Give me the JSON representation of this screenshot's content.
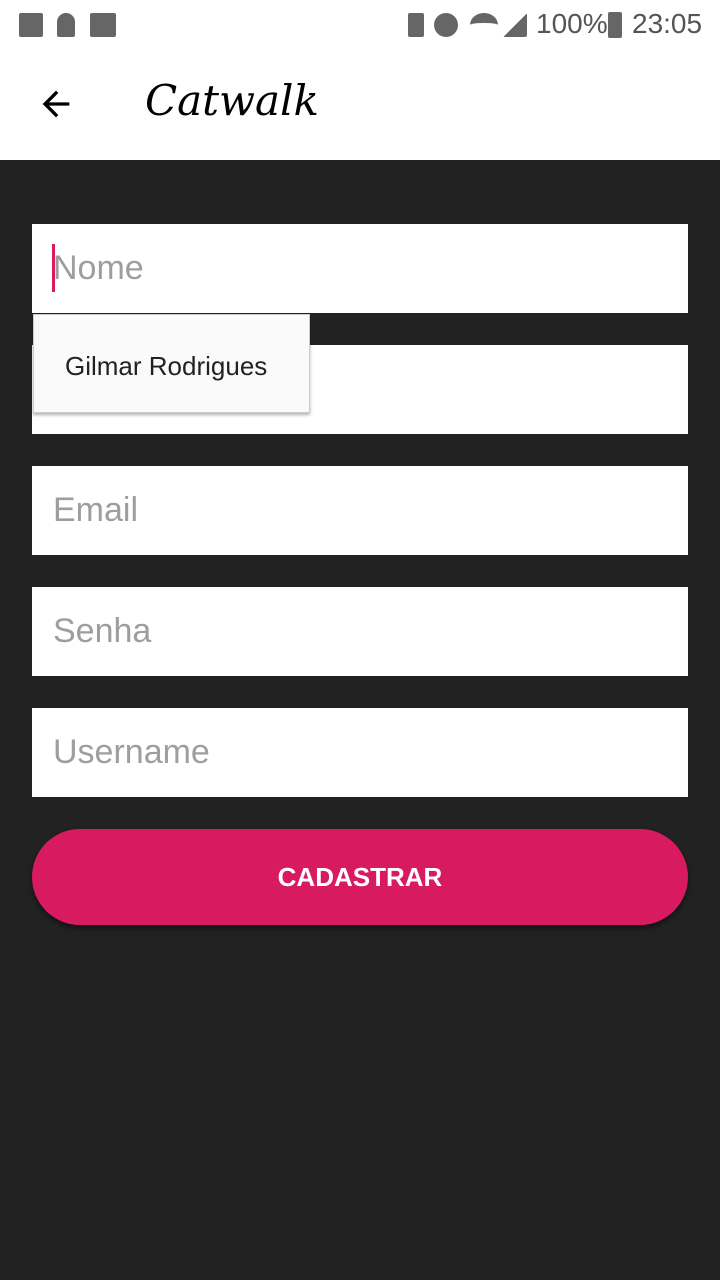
{
  "status": {
    "battery": "100%",
    "time": "23:05"
  },
  "appbar": {
    "title": "Catwalk"
  },
  "form": {
    "nome_placeholder": "Nome",
    "field2_placeholder": "",
    "email_placeholder": "Email",
    "senha_placeholder": "Senha",
    "username_placeholder": "Username",
    "submit_label": "CADASTRAR"
  },
  "autocomplete": {
    "suggestion": "Gilmar Rodrigues"
  },
  "colors": {
    "accent": "#d81b60",
    "background": "#222222"
  }
}
